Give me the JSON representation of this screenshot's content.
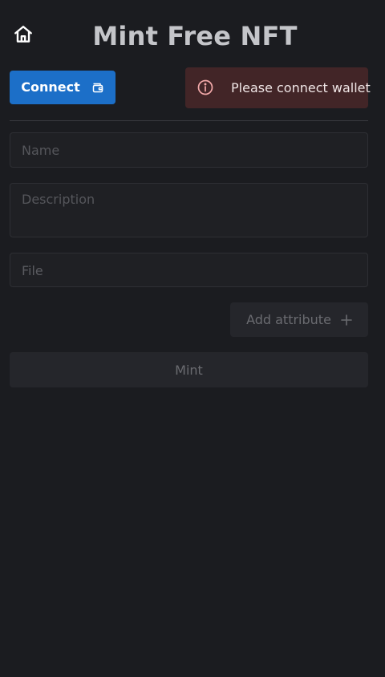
{
  "header": {
    "title": "Mint Free NFT",
    "home_icon": "home-icon"
  },
  "toolbar": {
    "connect_label": "Connect",
    "connect_icon": "wallet-icon",
    "accent_color": "#1c6fc8"
  },
  "alert": {
    "icon": "info-circle-icon",
    "message": "Please connect wallet",
    "background_color": "#422527"
  },
  "form": {
    "name": {
      "placeholder": "Name",
      "value": ""
    },
    "description": {
      "placeholder": "Description",
      "value": ""
    },
    "file": {
      "placeholder": "File"
    },
    "add_attribute_label": "Add attribute",
    "add_attribute_icon": "plus-icon",
    "mint_label": "Mint"
  }
}
